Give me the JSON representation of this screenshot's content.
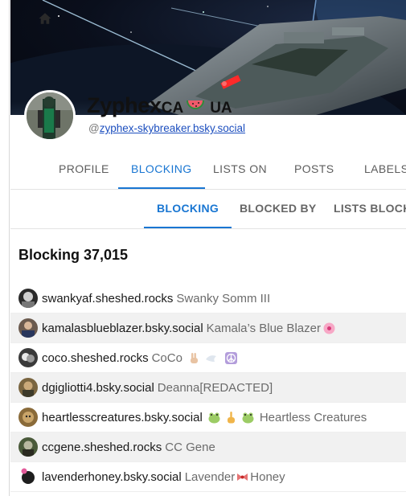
{
  "profile": {
    "display_name": "Zyphex",
    "name_suffix_a": "CA",
    "name_suffix_b": "UA",
    "handle_prefix": "@",
    "handle": "zyphex-skybreaker.bsky.social"
  },
  "main_tabs": [
    {
      "label": "PROFILE",
      "active": false
    },
    {
      "label": "BLOCKING",
      "active": true
    },
    {
      "label": "LISTS ON",
      "active": false
    },
    {
      "label": "POSTS",
      "active": false
    },
    {
      "label": "LABELS",
      "active": false
    }
  ],
  "sub_tabs": [
    {
      "label": "BLOCKING",
      "active": true
    },
    {
      "label": "BLOCKED BY",
      "active": false
    },
    {
      "label": "LISTS BLOCKED",
      "active": false
    }
  ],
  "section": {
    "title": "Blocking 37,015"
  },
  "rows": [
    {
      "handle": "swankyaf.sheshed.rocks",
      "name": "Swanky Somm III",
      "avatar_color": "#2a2a2a"
    },
    {
      "handle": "kamalasblueblazer.bsky.social",
      "name": "Kamala’s Blue Blazer",
      "avatar_color": "#6b5a4e"
    },
    {
      "handle": "coco.sheshed.rocks",
      "name": "CoCo",
      "avatar_color": "#3a3a3a"
    },
    {
      "handle": "dgigliotti4.bsky.social",
      "name": "Deanna[REDACTED]",
      "avatar_color": "#7a6540"
    },
    {
      "handle": "heartlesscreatures.bsky.social",
      "name": "Heartless Creatures",
      "avatar_color": "#8a6b3a"
    },
    {
      "handle": "ccgene.sheshed.rocks",
      "name": "CC Gene",
      "avatar_color": "#4a5a3a"
    },
    {
      "handle": "lavenderhoney.bsky.social",
      "name_a": "Lavender",
      "name_b": "Honey",
      "avatar_color": "#1e1e1e"
    }
  ],
  "colors": {
    "accent": "#1976d2",
    "link": "#1d4fbf"
  },
  "icons": [
    "home-icon",
    "watermelon-icon",
    "hibiscus-icon",
    "victory-hand-icon",
    "dove-icon",
    "peace-symbol-icon",
    "frog-icon",
    "middle-finger-icon",
    "ribbon-icon"
  ]
}
